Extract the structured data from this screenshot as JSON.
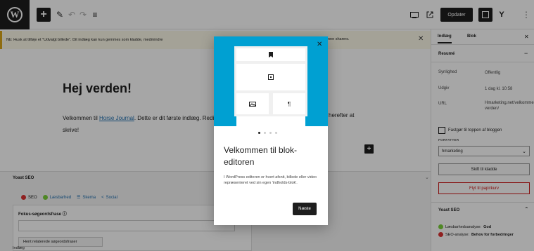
{
  "toolbar": {
    "logo": "W",
    "add_icon": "+",
    "edit_icon": "✎",
    "undo_icon": "↶",
    "redo_icon": "↷",
    "list_icon": "≡",
    "update_label": "Opdater",
    "yoast_label": "Y",
    "more_icon": "⋮"
  },
  "notice": {
    "text": "Nb: Husk at tilføje et \"Udvalgt billede\". Dit indlæg kan kun gemmes som kladde, medmindre",
    "tail": "nne sharers.",
    "close": "✕"
  },
  "editor": {
    "title": "Hej verden!",
    "content_prefix": "Velkommen til ",
    "content_link": "Horse Journal",
    "content_suffix": ". Dette er dit første indlæg. Rediger eller slet det,",
    "content_tail": "herefter at",
    "content_line2": "skrive!",
    "inserter": "+"
  },
  "yoast_panel": {
    "title": "Yoast SEO",
    "tabs": [
      {
        "label": "SEO",
        "color": "#dc3232"
      },
      {
        "label": "Læsbarhed",
        "color": "#7ad03a"
      },
      {
        "label": "Skema",
        "color": "#2271b1"
      },
      {
        "label": "Social",
        "color": "#2271b1"
      }
    ],
    "focus_label": "Fokus-søgeordsfrase",
    "related_label": "Hent relaterede søgeordsfraser",
    "footer_label": "Indlæg"
  },
  "sidebar": {
    "tab_post": "Indlæg",
    "tab_block": "Blok",
    "close": "✕",
    "summary_title": "Resumé",
    "rows": [
      {
        "label": "Synlighed",
        "value": "Offentlig"
      },
      {
        "label": "Udgiv",
        "value": "1 dag kl. 10:58"
      },
      {
        "label": "URL",
        "value": "Hmarketing.net/velkommen/hej-verden/"
      }
    ],
    "pin_label": "Fastgør til toppen af bloggen",
    "format_label": "FORFATTER",
    "author_value": "hmarketing",
    "draft_btn": "Skift til kladde",
    "trash_btn": "Flyt til papirkurv",
    "yoast_title": "Yoast SEO",
    "status": [
      {
        "prefix": "Læsbarhedsanalyse: ",
        "value": "God",
        "color": "#7ad03a"
      },
      {
        "prefix": "SEO-analyse: ",
        "value": "Behov for forbedringer",
        "color": "#dc3232"
      }
    ]
  },
  "modal": {
    "close": "✕",
    "title": "Velkommen til blok-editoren",
    "description": "I WordPress editoren er hvert afsnit, billede eller video repræsenteret ved sin egen 'indholds-blok'.",
    "next_label": "Næste",
    "icons": {
      "bookmark": "🔖",
      "square": "⊡",
      "image": "▭",
      "paragraph": "¶"
    }
  }
}
